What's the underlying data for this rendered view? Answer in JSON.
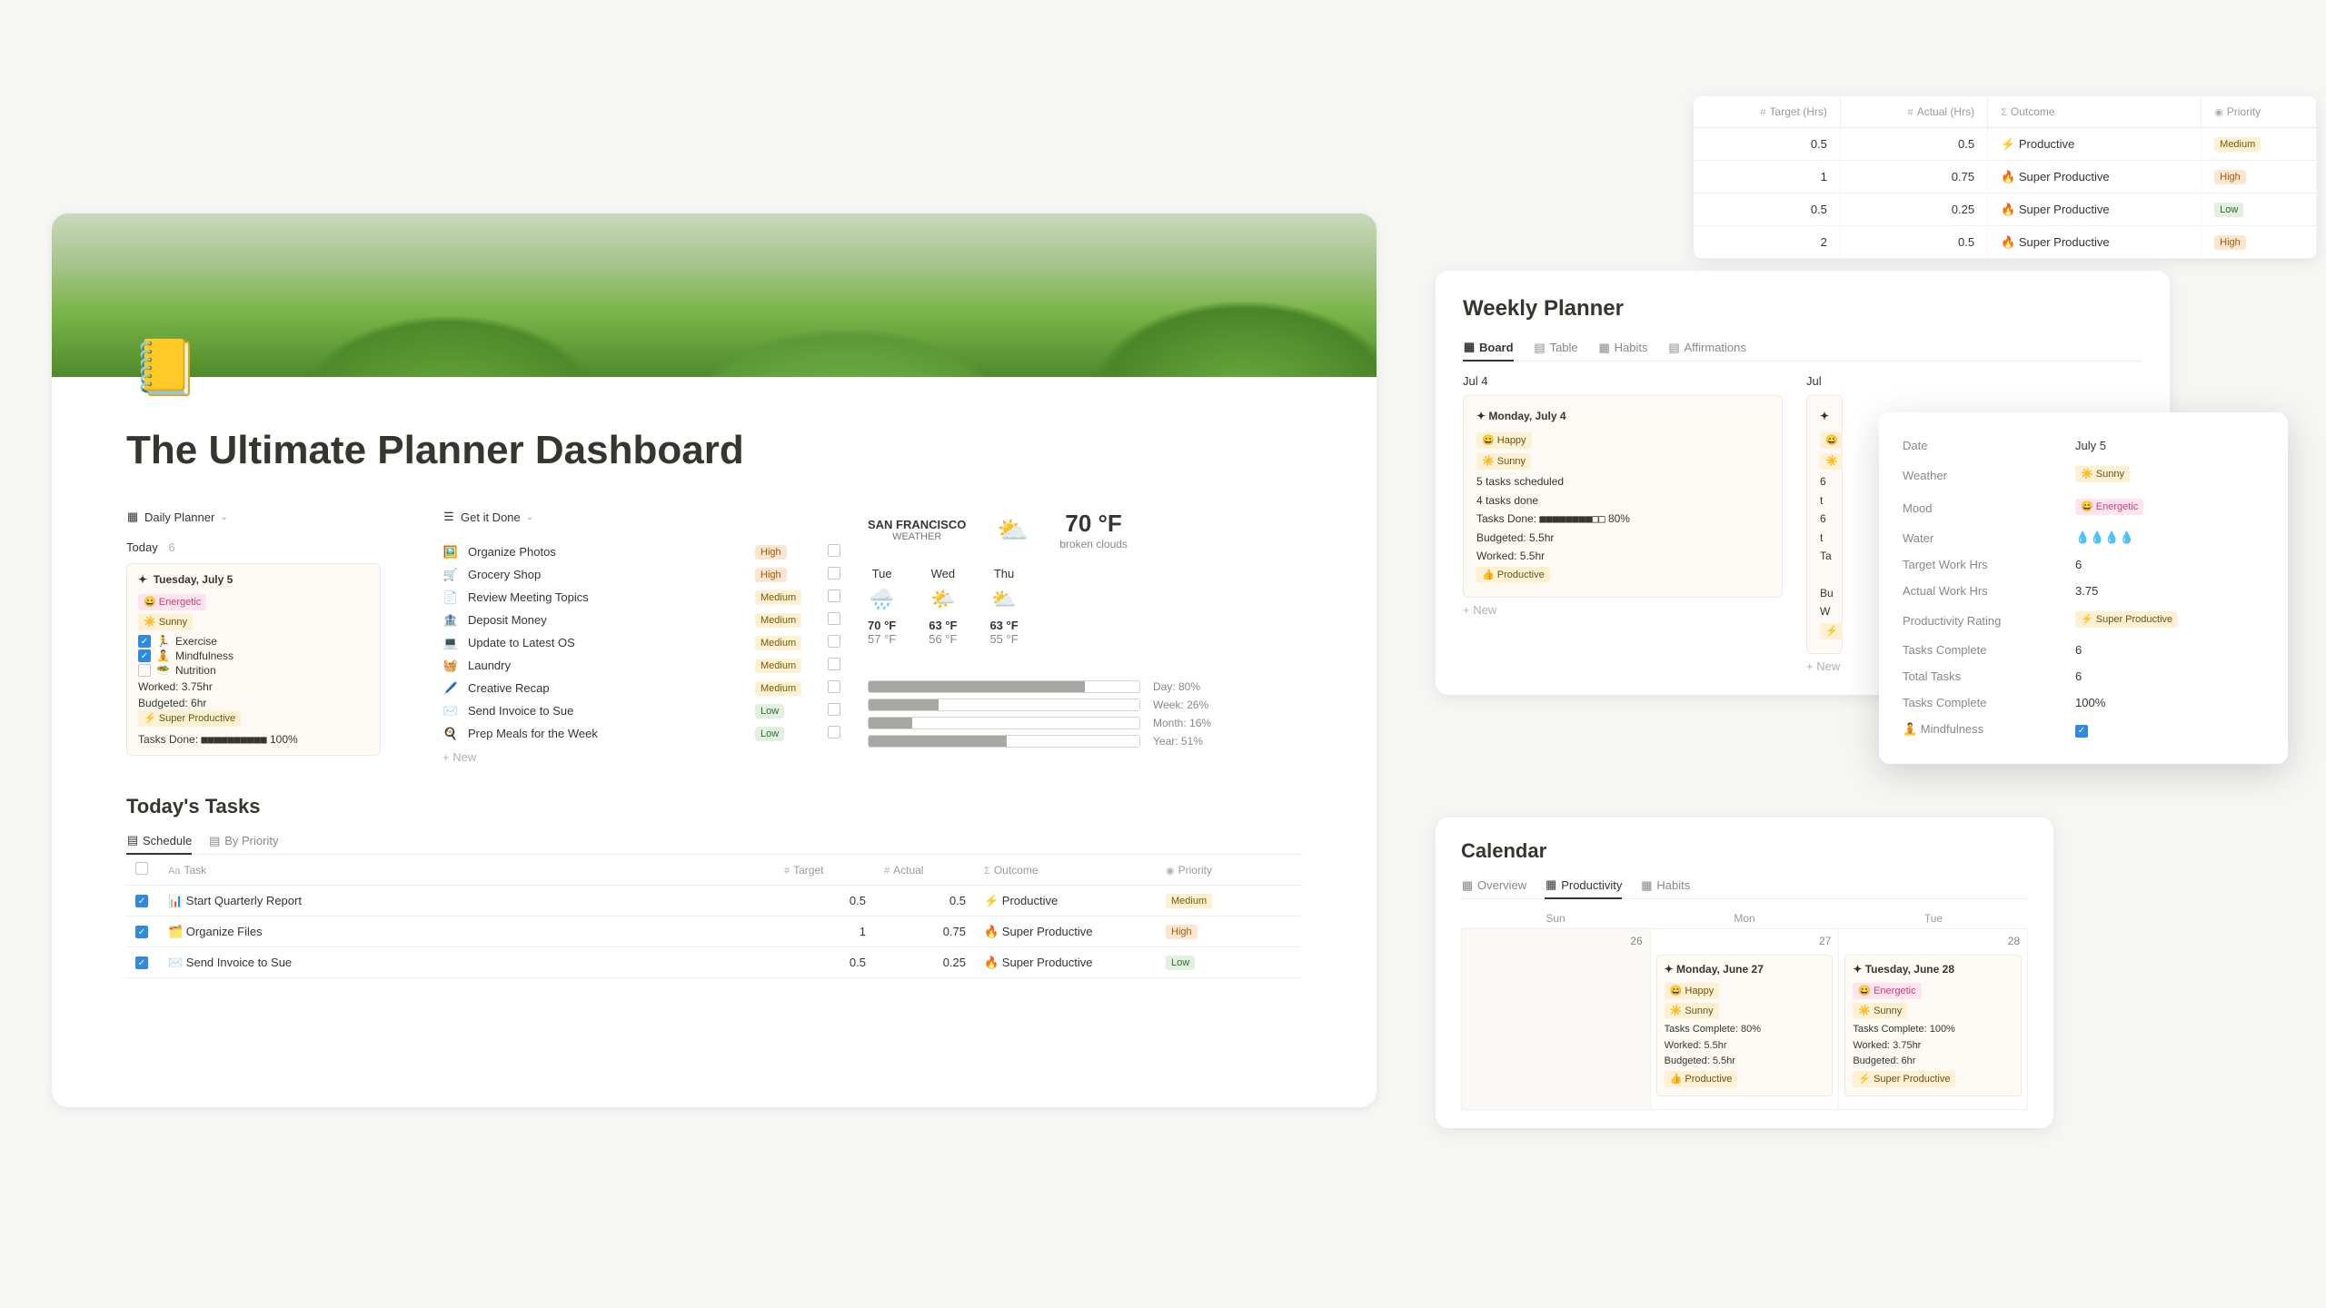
{
  "main": {
    "icon": "📒",
    "title": "The Ultimate Planner Dashboard",
    "daily_header": "Daily Planner",
    "gid_header": "Get it Done",
    "today_label": "Today",
    "today_count": "6",
    "daily": {
      "date": "Tuesday, July 5",
      "mood": "😄 Energetic",
      "weather": "☀️ Sunny",
      "habits": [
        {
          "done": true,
          "emoji": "🏃",
          "label": "Exercise"
        },
        {
          "done": true,
          "emoji": "🧘",
          "label": "Mindfulness"
        },
        {
          "done": false,
          "emoji": "🥗",
          "label": "Nutrition"
        }
      ],
      "worked": "Worked: 3.75hr",
      "budgeted": "Budgeted: 6hr",
      "prod": "⚡ Super Productive",
      "tasks_done_label": "Tasks Done:",
      "tasks_done_bar": "■■■■■■■■■■",
      "tasks_done_pct": "100%"
    },
    "gid": [
      {
        "emoji": "🖼️",
        "text": "Organize Photos",
        "prio": "High",
        "pc": "b-high"
      },
      {
        "emoji": "🛒",
        "text": "Grocery Shop",
        "prio": "High",
        "pc": "b-high"
      },
      {
        "emoji": "📄",
        "text": "Review Meeting Topics",
        "prio": "Medium",
        "pc": "b-medium"
      },
      {
        "emoji": "🏦",
        "text": "Deposit Money",
        "prio": "Medium",
        "pc": "b-medium"
      },
      {
        "emoji": "💻",
        "text": "Update to Latest OS",
        "prio": "Medium",
        "pc": "b-medium"
      },
      {
        "emoji": "🧺",
        "text": "Laundry",
        "prio": "Medium",
        "pc": "b-medium"
      },
      {
        "emoji": "🖊️",
        "text": "Creative Recap",
        "prio": "Medium",
        "pc": "b-medium"
      },
      {
        "emoji": "✉️",
        "text": "Send Invoice to Sue",
        "prio": "Low",
        "pc": "b-low"
      },
      {
        "emoji": "🍳",
        "text": "Prep Meals for the Week",
        "prio": "Low",
        "pc": "b-low"
      }
    ],
    "new_label": "+  New",
    "weather": {
      "city": "SAN FRANCISCO",
      "city_sub": "WEATHER",
      "icon": "⛅",
      "temp": "70 °F",
      "desc": "broken clouds",
      "days": [
        {
          "d": "Tue",
          "icn": "🌧️",
          "hi": "70 °F",
          "lo": "57 °F"
        },
        {
          "d": "Wed",
          "icn": "🌤️",
          "hi": "63 °F",
          "lo": "56 °F"
        },
        {
          "d": "Thu",
          "icn": "⛅",
          "hi": "63 °F",
          "lo": "55 °F"
        }
      ],
      "progress": [
        {
          "label": "Day: 80%",
          "pct": 80
        },
        {
          "label": "Week: 26%",
          "pct": 26
        },
        {
          "label": "Month: 16%",
          "pct": 16
        },
        {
          "label": "Year: 51%",
          "pct": 51
        }
      ]
    },
    "tt_title": "Today's Tasks",
    "tt_tabs": {
      "schedule": "Schedule",
      "priority": "By Priority"
    },
    "tt_headers": {
      "chk": "",
      "task": "Task",
      "target": "Target",
      "actual": "Actual",
      "outcome": "Outcome",
      "prio": "Priority"
    },
    "tt_rows": [
      {
        "chk": true,
        "emoji": "📊",
        "task": "Start Quarterly Report",
        "target": "0.5",
        "actual": "0.5",
        "outcome": "⚡ Productive",
        "prio": "Medium",
        "pc": "b-medium"
      },
      {
        "chk": true,
        "emoji": "🗂️",
        "task": "Organize Files",
        "target": "1",
        "actual": "0.75",
        "outcome": "🔥 Super Productive",
        "prio": "High",
        "pc": "b-high"
      },
      {
        "chk": true,
        "emoji": "✉️",
        "task": "Send Invoice to Sue",
        "target": "0.5",
        "actual": "0.25",
        "outcome": "🔥 Super Productive",
        "prio": "Low",
        "pc": "b-low"
      }
    ]
  },
  "mini": {
    "headers": {
      "target": "Target (Hrs)",
      "actual": "Actual (Hrs)",
      "outcome": "Outcome",
      "prio": "Priority"
    },
    "rows": [
      {
        "target": "0.5",
        "actual": "0.5",
        "outcome": "⚡ Productive",
        "prio": "Medium",
        "pc": "b-medium"
      },
      {
        "target": "1",
        "actual": "0.75",
        "outcome": "🔥 Super Productive",
        "prio": "High",
        "pc": "b-high"
      },
      {
        "target": "0.5",
        "actual": "0.25",
        "outcome": "🔥 Super Productive",
        "prio": "Low",
        "pc": "b-low"
      },
      {
        "target": "2",
        "actual": "0.5",
        "outcome": "🔥 Super Productive",
        "prio": "High",
        "pc": "b-high"
      }
    ]
  },
  "weekly": {
    "title": "Weekly Planner",
    "tabs": {
      "board": "Board",
      "table": "Table",
      "habits": "Habits",
      "aff": "Affirmations"
    },
    "cols": [
      {
        "head": "Jul 4",
        "card": {
          "date": "✦  Monday, July 4",
          "mood": "😄 Happy",
          "wx": "☀️ Sunny",
          "l1": "5 tasks scheduled",
          "l2": "4 tasks done",
          "l3_label": "Tasks Done:",
          "l3_bar": "■■■■■■■■□□",
          "l3_pct": "80%",
          "l4": "Budgeted: 5.5hr",
          "l5": "Worked: 5.5hr",
          "l6": "👍 Productive"
        }
      },
      {
        "head": "Jul",
        "card": {
          "date": "✦",
          "mood": "😄",
          "wx": "☀️",
          "l1": "6 t",
          "l2": "6 t",
          "l3_label": "Ta",
          "l3_bar": "",
          "l3_pct": "",
          "l4": "Bu",
          "l5": "W",
          "l6": "⚡"
        }
      }
    ],
    "new": "+  New"
  },
  "detail": {
    "rows": [
      {
        "k": "Date",
        "v": "July 5"
      },
      {
        "k": "Weather",
        "v": "☀️ Sunny",
        "pill": "pill-yellow"
      },
      {
        "k": "Mood",
        "v": "😄 Energetic",
        "pill": "pill-pink"
      },
      {
        "k": "Water",
        "v": "💧💧💧💧"
      },
      {
        "k": "Target Work Hrs",
        "v": "6"
      },
      {
        "k": "Actual Work Hrs",
        "v": "3.75"
      },
      {
        "k": "Productivity Rating",
        "v": "⚡ Super Productive",
        "pill": "pill-yellow"
      },
      {
        "k": "Tasks Complete",
        "v": "6"
      },
      {
        "k": "Total Tasks",
        "v": "6"
      },
      {
        "k": "Tasks Complete",
        "v": "100%"
      },
      {
        "k": "🧘 Mindfulness",
        "v": "",
        "check": true
      }
    ]
  },
  "calendar": {
    "title": "Calendar",
    "tabs": {
      "over": "Overview",
      "prod": "Productivity",
      "habits": "Habits"
    },
    "days_head": [
      "Sun",
      "Mon",
      "Tue"
    ],
    "cells": [
      {
        "num": "26",
        "event": null
      },
      {
        "num": "27",
        "event": {
          "title": "✦  Monday, June 27",
          "mood": "😄 Happy",
          "mood_pill": "pill-yellow",
          "wx": "☀️ Sunny",
          "l1": "Tasks Complete: 80%",
          "l2": "Worked: 5.5hr",
          "l3": "Budgeted: 5.5hr",
          "l4": "👍 Productive"
        }
      },
      {
        "num": "28",
        "event": {
          "title": "✦  Tuesday, June 28",
          "mood": "😄 Energetic",
          "mood_pill": "pill-pink",
          "wx": "☀️ Sunny",
          "l1": "Tasks Complete: 100%",
          "l2": "Worked: 3.75hr",
          "l3": "Budgeted: 6hr",
          "l4": "⚡ Super Productive"
        }
      }
    ]
  }
}
